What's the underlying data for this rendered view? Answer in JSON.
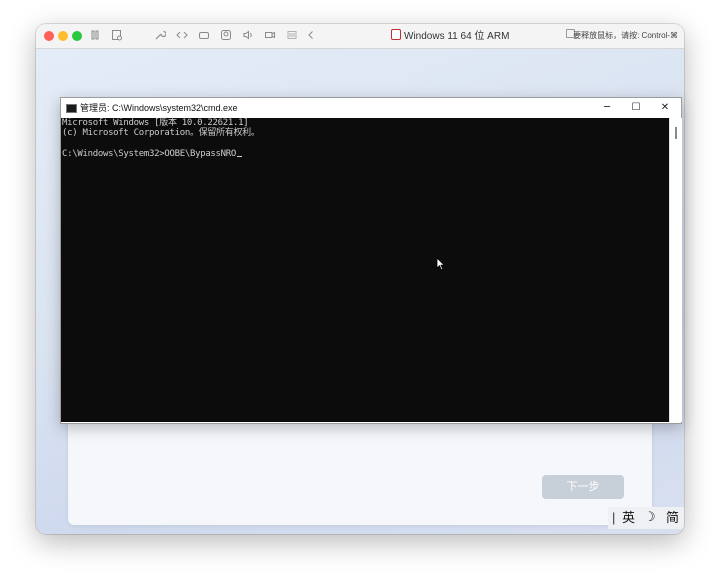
{
  "mac_window": {
    "title": "Windows 11 64 位 ARM",
    "hint": "要释放鼠标，请按: Control-⌘"
  },
  "cmd": {
    "title": "管理员: C:\\Windows\\system32\\cmd.exe",
    "minimize": "─",
    "maximize": "☐",
    "close": "✕",
    "lines": [
      "Microsoft Windows [版本 10.0.22621.1]",
      "(c) Microsoft Corporation。保留所有权利。",
      "",
      "C:\\Windows\\System32>OOBE\\BypassNRO"
    ]
  },
  "oobe": {
    "next_button": "下一步"
  },
  "ime": {
    "mode": "英",
    "moon": "☽",
    "script": "简"
  },
  "colors": {
    "console_bg": "#0c0c0c",
    "console_text": "#cccccc",
    "next_button_bg": "#c7cfd9"
  },
  "icons": {
    "pause": "pause-icon",
    "config": "config-icon",
    "tools": "wrench-icon",
    "code": "code-icon",
    "drive": "drive-icon",
    "user": "user-icon",
    "sound": "speaker-icon",
    "camera": "camera-icon",
    "list": "list-icon",
    "back": "chevron-left-icon"
  }
}
